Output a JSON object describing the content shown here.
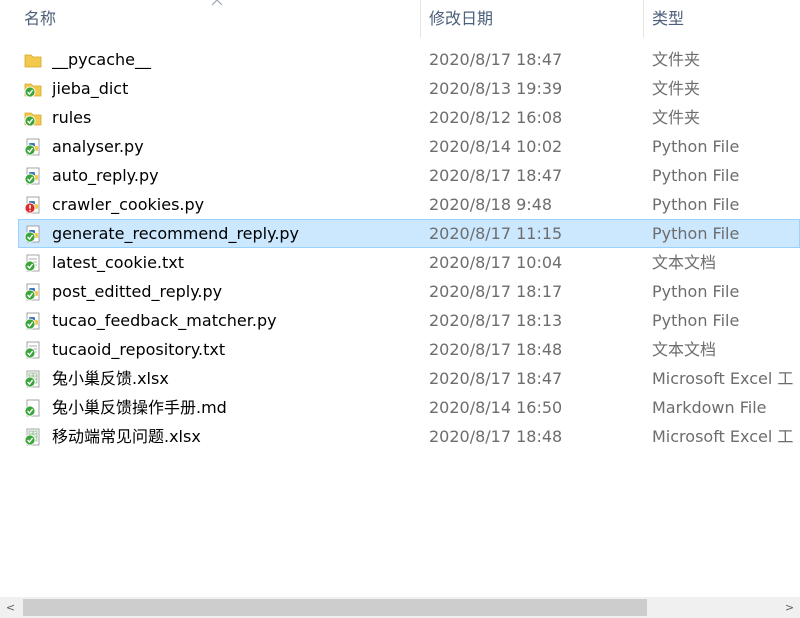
{
  "columns": {
    "name": "名称",
    "date": "修改日期",
    "type": "类型"
  },
  "files": [
    {
      "name": "__pycache__",
      "date": "2020/8/17 18:47",
      "type": "文件夹",
      "icon": "folder-icon",
      "status": "none"
    },
    {
      "name": "jieba_dict",
      "date": "2020/8/13 19:39",
      "type": "文件夹",
      "icon": "folder-icon",
      "status": "synced"
    },
    {
      "name": "rules",
      "date": "2020/8/12 16:08",
      "type": "文件夹",
      "icon": "folder-icon",
      "status": "synced"
    },
    {
      "name": "analyser.py",
      "date": "2020/8/14 10:02",
      "type": "Python File",
      "icon": "python-file-icon",
      "status": "synced"
    },
    {
      "name": "auto_reply.py",
      "date": "2020/8/17 18:47",
      "type": "Python File",
      "icon": "python-file-icon",
      "status": "synced"
    },
    {
      "name": "crawler_cookies.py",
      "date": "2020/8/18 9:48",
      "type": "Python File",
      "icon": "python-file-icon",
      "status": "modified"
    },
    {
      "name": "generate_recommend_reply.py",
      "date": "2020/8/17 11:15",
      "type": "Python File",
      "icon": "python-file-icon",
      "status": "synced"
    },
    {
      "name": "latest_cookie.txt",
      "date": "2020/8/17 10:04",
      "type": "文本文档",
      "icon": "text-file-icon",
      "status": "synced"
    },
    {
      "name": "post_editted_reply.py",
      "date": "2020/8/17 18:17",
      "type": "Python File",
      "icon": "python-file-icon",
      "status": "synced"
    },
    {
      "name": "tucao_feedback_matcher.py",
      "date": "2020/8/17 18:13",
      "type": "Python File",
      "icon": "python-file-icon",
      "status": "synced"
    },
    {
      "name": "tucaoid_repository.txt",
      "date": "2020/8/17 18:48",
      "type": "文本文档",
      "icon": "text-file-icon",
      "status": "synced"
    },
    {
      "name": "兔小巢反馈.xlsx",
      "date": "2020/8/17 18:47",
      "type": "Microsoft Excel 工",
      "icon": "excel-file-icon",
      "status": "synced"
    },
    {
      "name": "兔小巢反馈操作手册.md",
      "date": "2020/8/14 16:50",
      "type": "Markdown File",
      "icon": "markdown-file-icon",
      "status": "synced"
    },
    {
      "name": "移动端常见问题.xlsx",
      "date": "2020/8/17 18:48",
      "type": "Microsoft Excel 工",
      "icon": "excel-file-icon",
      "status": "synced"
    }
  ],
  "selected_index": 6,
  "colors": {
    "header_text": "#4c607a",
    "selection_bg": "#cce8ff",
    "selection_border": "#99d1ff",
    "secondary_text": "#6d6d6d",
    "synced_badge": "#3aa63a",
    "modified_badge": "#d92b2b",
    "folder": "#f2c94c"
  },
  "scrollbar": {
    "left_arrow": "<",
    "right_arrow": ">"
  }
}
